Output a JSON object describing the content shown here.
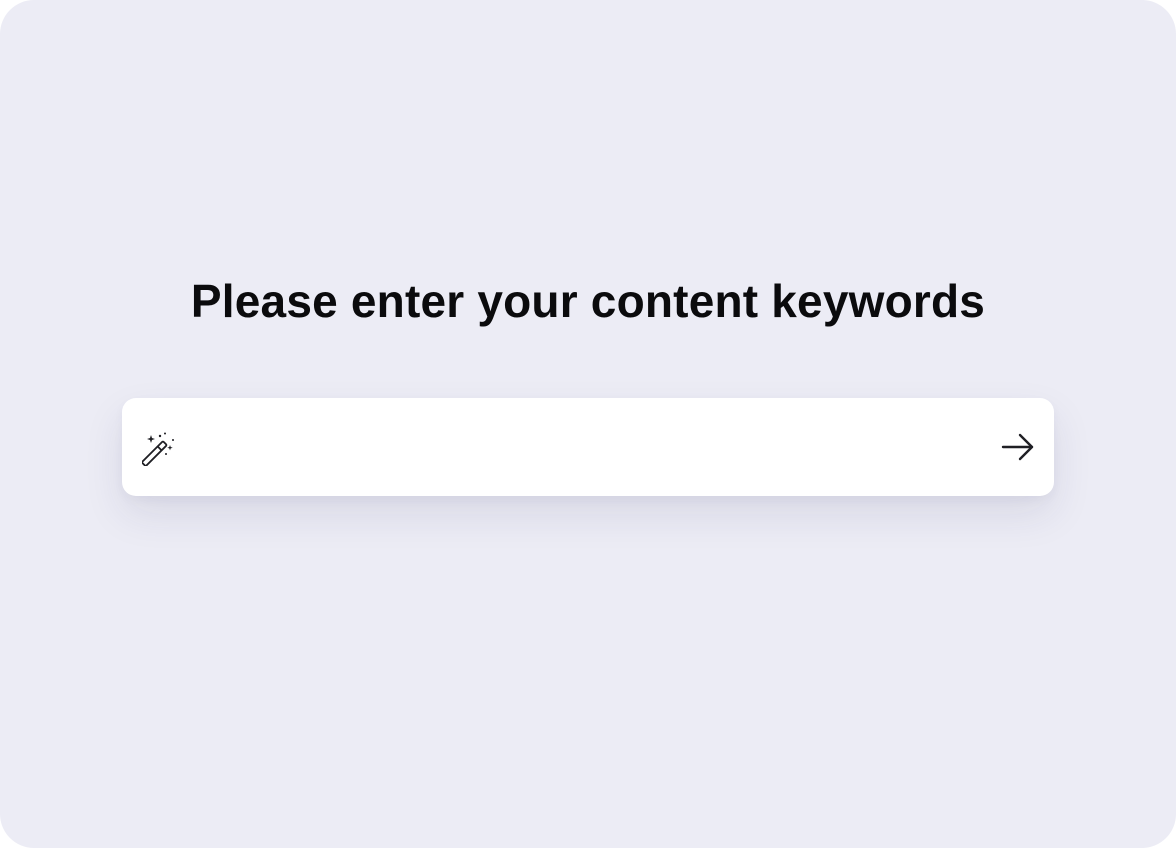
{
  "prompt": {
    "title": "Please enter your content keywords"
  },
  "search": {
    "value": "",
    "placeholder": "",
    "leading_icon": "magic-wand-icon",
    "submit_icon": "arrow-right-icon"
  },
  "colors": {
    "background": "#ECECF5",
    "card": "#FFFFFF",
    "text": "#0B0B0D",
    "icon": "#1F1F24"
  }
}
